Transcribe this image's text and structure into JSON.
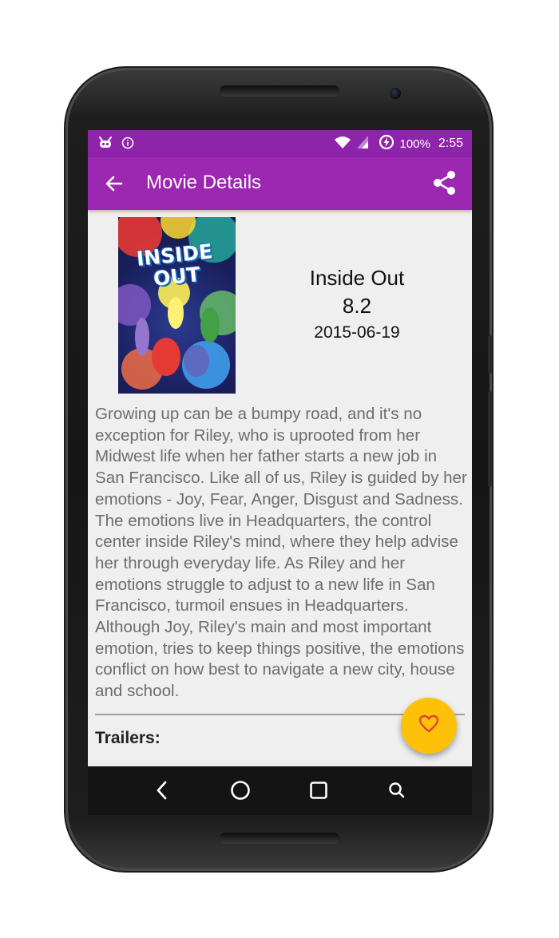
{
  "status_bar": {
    "battery": "100%",
    "time": "2:55",
    "icons": [
      "android-debug-icon",
      "info-icon",
      "wifi-icon",
      "cellular-signal-icon",
      "battery-saver-icon"
    ]
  },
  "app_bar": {
    "title": "Movie Details",
    "icons": [
      "back-arrow-icon",
      "share-icon"
    ]
  },
  "movie": {
    "poster_text": "INSIDE OUT",
    "title": "Inside Out",
    "rating": "8.2",
    "release_date": "2015-06-19",
    "overview": "Growing up can be a bumpy road, and it's no exception for Riley, who is uprooted from her Midwest life when her father starts a new job in San Francisco. Like all of us, Riley is guided by her emotions - Joy, Fear, Anger, Disgust and Sadness. The emotions live in Headquarters, the control center inside Riley's mind, where they help advise her through everyday life. As Riley and her emotions struggle to adjust to a new life in San Francisco, turmoil ensues in Headquarters. Although Joy, Riley's main and most important emotion, tries to keep things positive, the emotions conflict on how best to navigate a new city, house and school."
  },
  "trailers": {
    "label": "Trailers:"
  },
  "fab": {
    "icon": "heart-outline-icon"
  },
  "nav_bar": {
    "icons": [
      "back-triangle-icon",
      "home-circle-icon",
      "recents-square-icon",
      "search-icon"
    ]
  },
  "colors": {
    "status_bar": "#8e24aa",
    "app_bar": "#9c27b0",
    "background": "#efefef",
    "fab": "#ffc107",
    "fab_icon": "#e53935",
    "overview_text": "#6d6d6d"
  }
}
